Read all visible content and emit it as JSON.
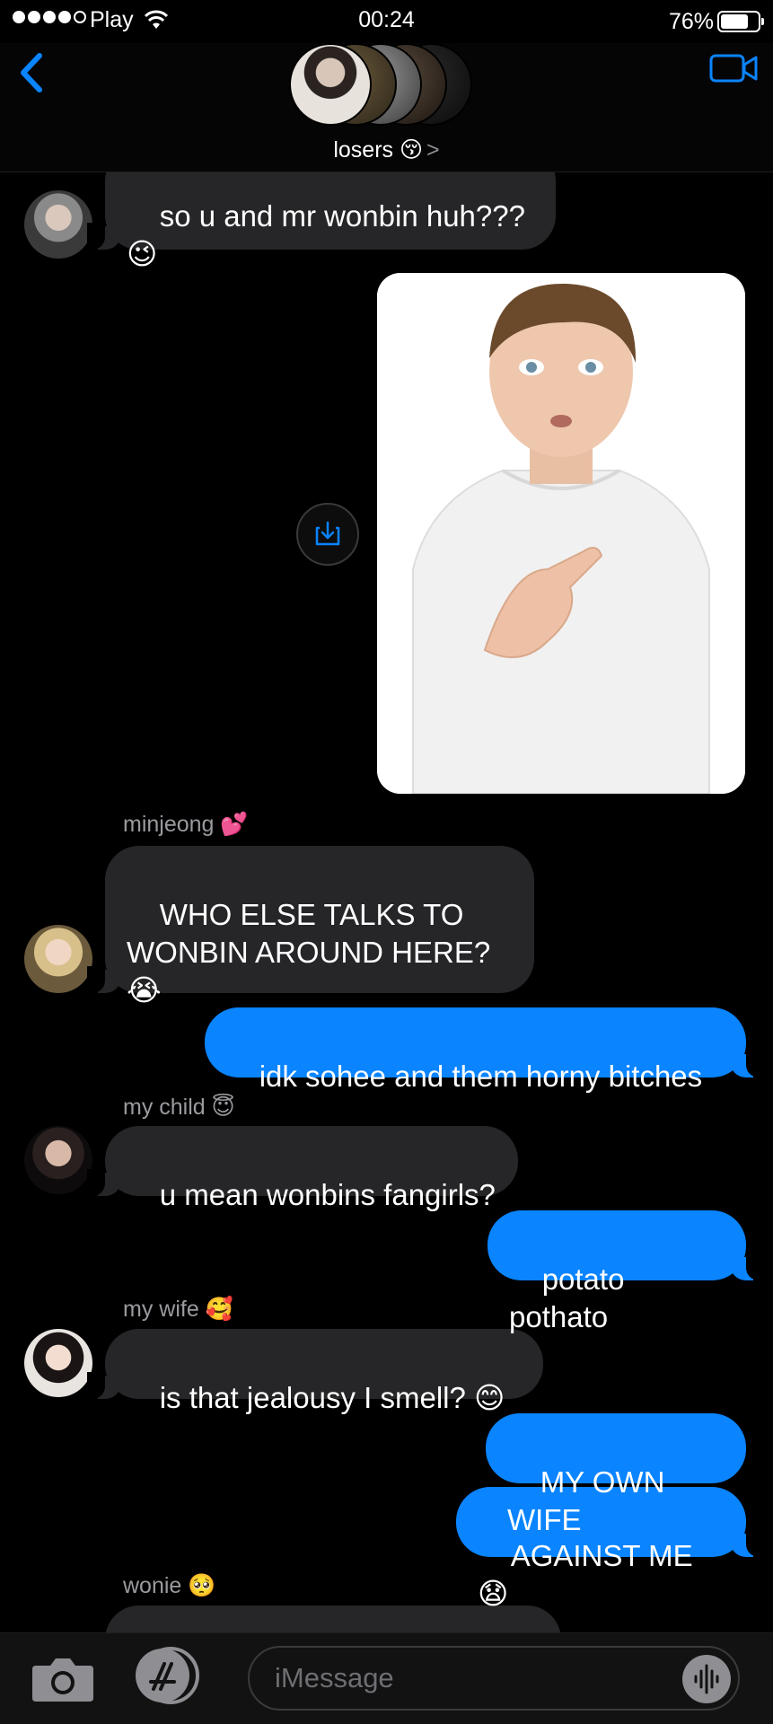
{
  "status_bar": {
    "carrier": "Play",
    "time": "00:24",
    "battery": "76%",
    "battery_level": 0.76
  },
  "header": {
    "group_name": "losers",
    "group_emoji": "😚",
    "chevron": ">"
  },
  "messages": [
    {
      "sender": "",
      "text": "so u and mr wonbin huh???\n😉",
      "direction": "in"
    },
    {
      "type": "photo",
      "direction": "out"
    },
    {
      "sender": "minjeong",
      "sender_emoji": "💕",
      "text": "WHO ELSE TALKS TO\nWONBIN AROUND HERE?\n😭",
      "direction": "in"
    },
    {
      "text": "idk sohee and them horny bitches",
      "direction": "out"
    },
    {
      "sender": "my child",
      "sender_emoji": "😇",
      "text": "u mean wonbins fangirls?",
      "direction": "in"
    },
    {
      "text": "potato pothato",
      "direction": "out"
    },
    {
      "sender": "my wife",
      "sender_emoji": "🥰",
      "text": "is that jealousy I smell? 😊",
      "direction": "in"
    },
    {
      "text": "MY OWN WIFE",
      "direction": "out"
    },
    {
      "text": "AGAINST ME 😧",
      "direction": "out"
    },
    {
      "sender": "wonie",
      "sender_emoji": "🥺",
      "text": "",
      "direction": "in"
    }
  ],
  "input": {
    "placeholder": "iMessage"
  },
  "icons": {
    "back": "chevron-left-icon",
    "video": "video-camera-icon",
    "camera": "camera-icon",
    "apps": "app-store-icon",
    "audio": "audio-waveform-icon",
    "save": "save-image-icon"
  },
  "colors": {
    "accent": "#0a84ff",
    "incoming_bubble": "#262628",
    "background": "#000000"
  }
}
